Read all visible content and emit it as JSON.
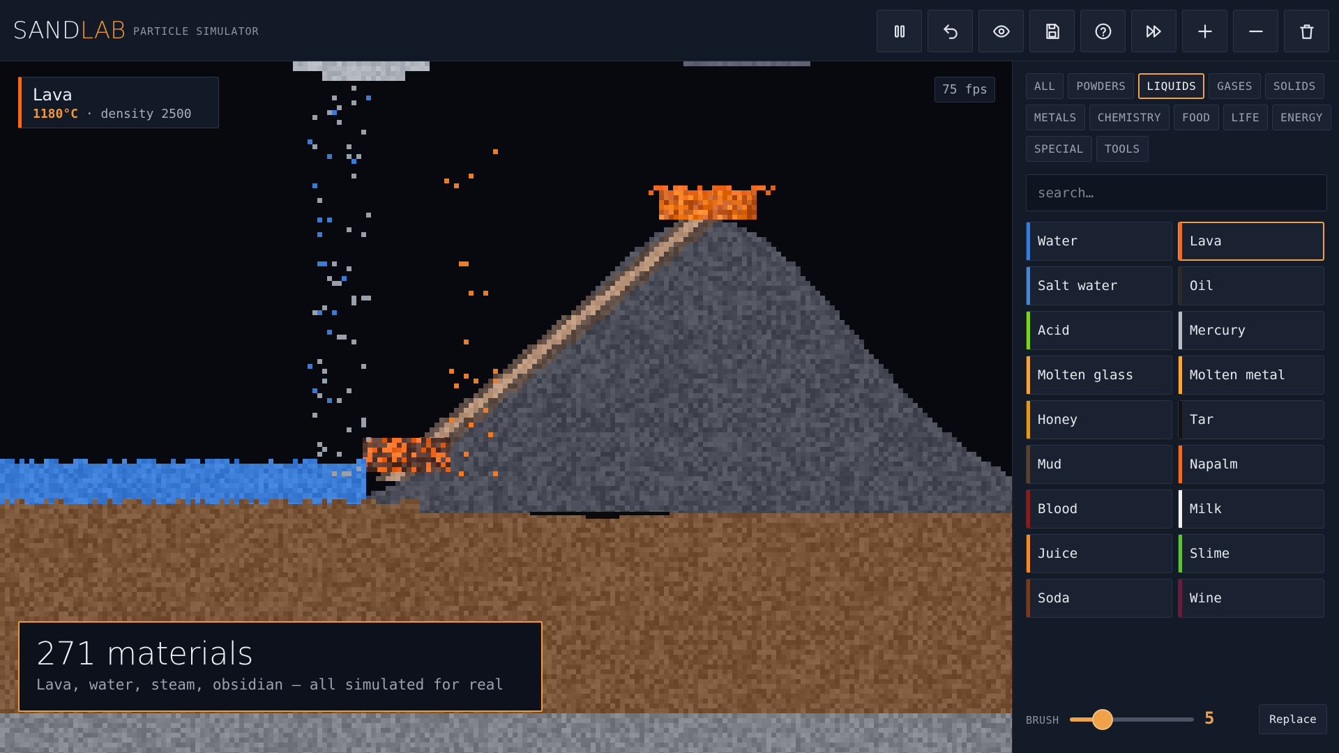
{
  "app": {
    "name_part1": "SAND",
    "name_part2": "LAB",
    "subtitle": "PARTICLE SIMULATOR"
  },
  "toolbar": [
    {
      "name": "pause-button",
      "icon": "pause-icon"
    },
    {
      "name": "undo-button",
      "icon": "undo-icon"
    },
    {
      "name": "view-button",
      "icon": "eye-icon"
    },
    {
      "name": "save-button",
      "icon": "save-icon"
    },
    {
      "name": "help-button",
      "icon": "help-icon"
    },
    {
      "name": "fast-forward-button",
      "icon": "fast-forward-icon"
    },
    {
      "name": "zoom-in-button",
      "icon": "plus-icon"
    },
    {
      "name": "zoom-out-button",
      "icon": "minus-icon"
    },
    {
      "name": "clear-button",
      "icon": "trash-icon"
    }
  ],
  "hover": {
    "name": "Lava",
    "temp": "1180°C",
    "sep": " · ",
    "density": "density 2500",
    "accent": "#f26a1f"
  },
  "fps": "75 fps",
  "promo": {
    "title": "271 materials",
    "subtitle": "Lava, water, steam, obsidian — all simulated for real"
  },
  "categories": [
    {
      "label": "ALL",
      "active": false
    },
    {
      "label": "POWDERS",
      "active": false
    },
    {
      "label": "LIQUIDS",
      "active": true
    },
    {
      "label": "GASES",
      "active": false
    },
    {
      "label": "SOLIDS",
      "active": false
    },
    {
      "label": "METALS",
      "active": false
    },
    {
      "label": "CHEMISTRY",
      "active": false
    },
    {
      "label": "FOOD",
      "active": false
    },
    {
      "label": "LIFE",
      "active": false
    },
    {
      "label": "ENERGY",
      "active": false
    },
    {
      "label": "SPECIAL",
      "active": false
    },
    {
      "label": "TOOLS",
      "active": false
    }
  ],
  "search": {
    "placeholder": "search…"
  },
  "materials": [
    {
      "label": "Water",
      "color": "#3a7bd5",
      "active": false
    },
    {
      "label": "Lava",
      "color": "#f26a1f",
      "active": true
    },
    {
      "label": "Salt water",
      "color": "#4a86c8",
      "active": false
    },
    {
      "label": "Oil",
      "color": "#2a2a2a",
      "active": false
    },
    {
      "label": "Acid",
      "color": "#7ed321",
      "active": false
    },
    {
      "label": "Mercury",
      "color": "#b8bec8",
      "active": false
    },
    {
      "label": "Molten glass",
      "color": "#f5a340",
      "active": false
    },
    {
      "label": "Molten metal",
      "color": "#f7a83a",
      "active": false
    },
    {
      "label": "Honey",
      "color": "#e09a1e",
      "active": false
    },
    {
      "label": "Tar",
      "color": "#121212",
      "active": false
    },
    {
      "label": "Mud",
      "color": "#5a4030",
      "active": false
    },
    {
      "label": "Napalm",
      "color": "#f26a1f",
      "active": false
    },
    {
      "label": "Blood",
      "color": "#8a1c1c",
      "active": false
    },
    {
      "label": "Milk",
      "color": "#f2f2f2",
      "active": false
    },
    {
      "label": "Juice",
      "color": "#f08a2a",
      "active": false
    },
    {
      "label": "Slime",
      "color": "#5fc23a",
      "active": false
    },
    {
      "label": "Soda",
      "color": "#7a3a20",
      "active": false
    },
    {
      "label": "Wine",
      "color": "#6a1a3a",
      "active": false
    }
  ],
  "brush": {
    "label": "BRUSH",
    "value": 5,
    "min": 1,
    "max": 16,
    "mode": "Replace"
  },
  "colors": {
    "accent": "#f0a24a",
    "water": "#3a7bd5",
    "dirt": "#7a5436",
    "rock": "#4a4d57",
    "stone": "#7c7f86",
    "lava": "#f26a1f"
  }
}
